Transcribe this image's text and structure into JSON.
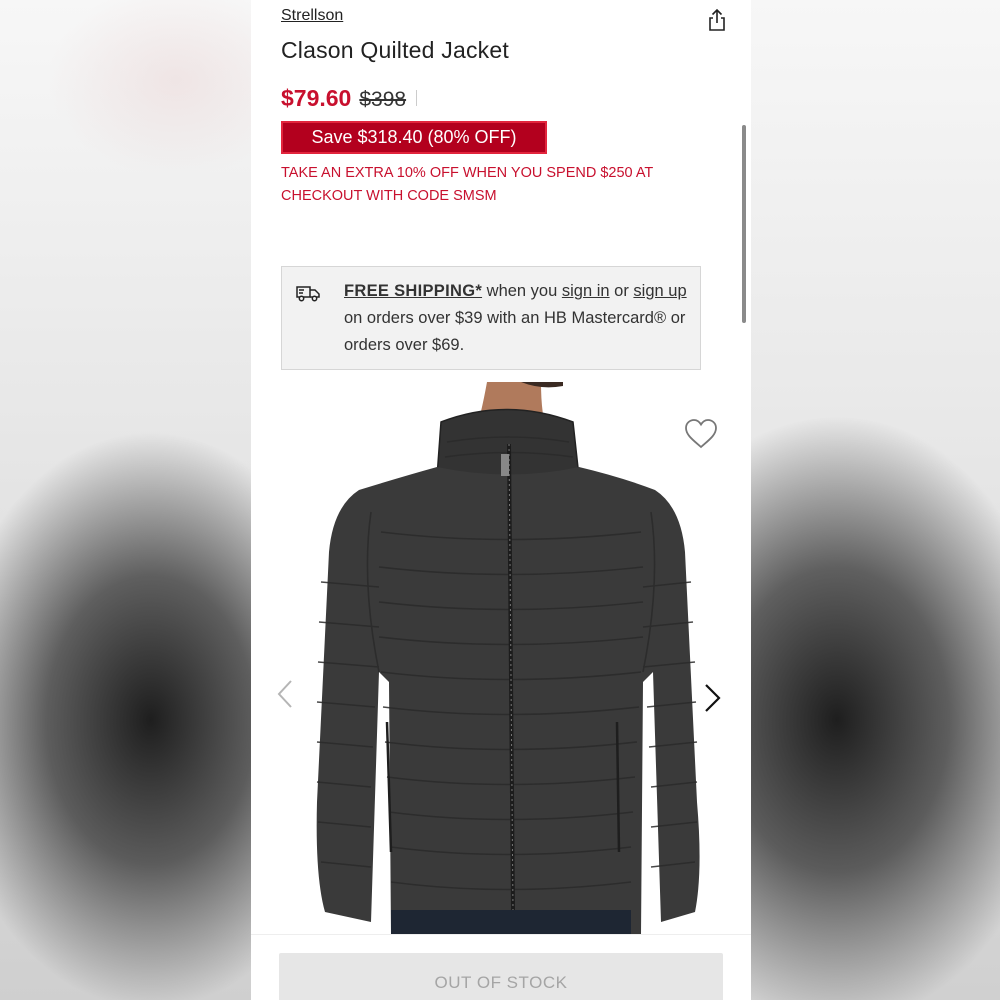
{
  "product": {
    "brand": "Strellson",
    "title": "Clason Quilted Jacket",
    "price_sale": "$79.60",
    "price_original": "$398",
    "save_badge": "Save $318.40 (80% OFF)",
    "promo_text": "TAKE AN EXTRA 10% OFF WHEN YOU SPEND $250 AT CHECKOUT WITH CODE SMSM"
  },
  "shipping": {
    "headline": "FREE SHIPPING*",
    "text_1": " when you ",
    "sign_in": "sign in",
    "text_2": " or ",
    "sign_up": "sign up",
    "text_3": " on orders over $39 with an HB Mastercard® or orders over $69."
  },
  "actions": {
    "cta_label": "OUT OF STOCK"
  },
  "colors": {
    "sale_red": "#c8102e",
    "badge_red": "#b3001e",
    "jacket": "#3a3a3a"
  },
  "icons": {
    "share": "share-icon",
    "truck": "truck-icon",
    "wishlist": "heart-icon",
    "prev": "chevron-left-icon",
    "next": "chevron-right-icon"
  }
}
